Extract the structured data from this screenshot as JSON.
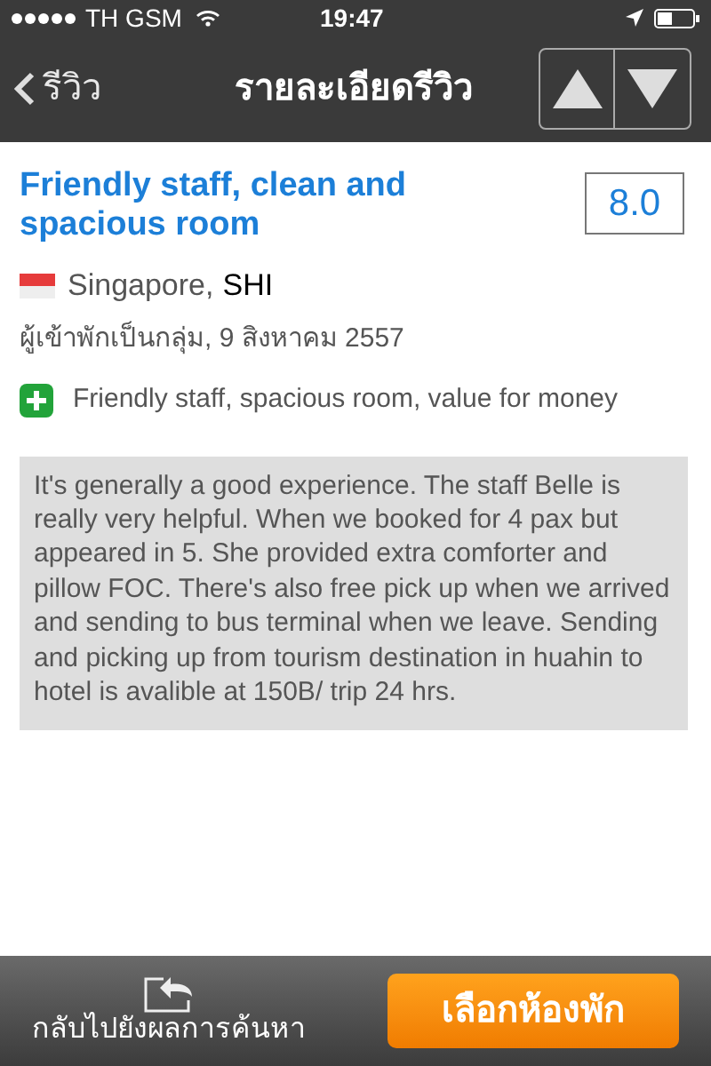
{
  "status_bar": {
    "carrier": "TH GSM",
    "time": "19:47"
  },
  "nav": {
    "back": "รีวิว",
    "title": "รายละเอียดรีวิว"
  },
  "review": {
    "title": "Friendly staff, clean and spacious room",
    "score": "8.0",
    "country": "Singapore,",
    "reviewer": "SHI",
    "meta": "ผู้เข้าพักเป็นกลุ่ม, 9 สิงหาคม 2557",
    "pros": "Friendly staff, spacious room, value for money",
    "body": "It's generally a good experience.  The staff Belle is really very helpful. When we booked for 4 pax but appeared in 5. She provided extra comforter and pillow FOC.  There's also free pick up when we arrived and sending to bus terminal when we leave.  Sending and picking up from tourism destination in huahin to hotel is avalible at 150B/ trip 24 hrs."
  },
  "bottom": {
    "back": "กลับไปยังผลการค้นหา",
    "book": "เลือกห้องพัก"
  }
}
